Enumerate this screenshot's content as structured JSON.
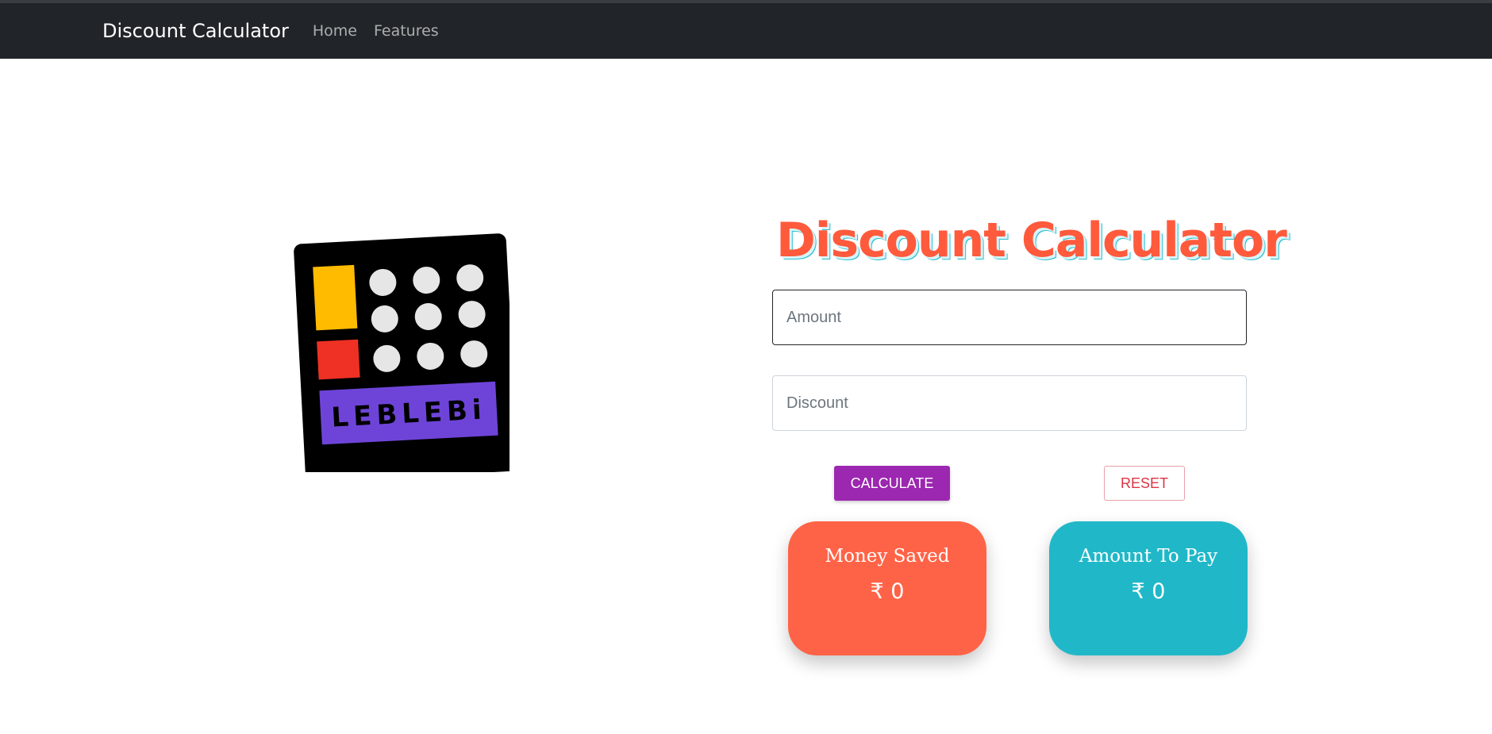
{
  "navbar": {
    "brand": "Discount Calculator",
    "links": [
      {
        "label": "Home"
      },
      {
        "label": "Features"
      }
    ]
  },
  "logo": {
    "text": "LEBLEBi",
    "colors": {
      "body": "#000000",
      "yellow": "#ffbb00",
      "red": "#ee3124",
      "purple": "#6e44d8",
      "dots": "#e6e6e6"
    }
  },
  "main": {
    "title": "Discount Calculator",
    "amount_placeholder": "Amount",
    "discount_placeholder": "Discount",
    "calculate_label": "CALCULATE",
    "reset_label": "RESET"
  },
  "cards": {
    "saved": {
      "title": "Money Saved",
      "value": "₹ 0"
    },
    "pay": {
      "title": "Amount To Pay",
      "value": "₹ 0"
    }
  },
  "colors": {
    "accent": "#ff5a3c",
    "calculate_bg": "#9c27b0",
    "reset_text": "#dc3545",
    "saved_card": "#ff6347",
    "pay_card": "#20b8c8",
    "navbar": "#212529"
  }
}
